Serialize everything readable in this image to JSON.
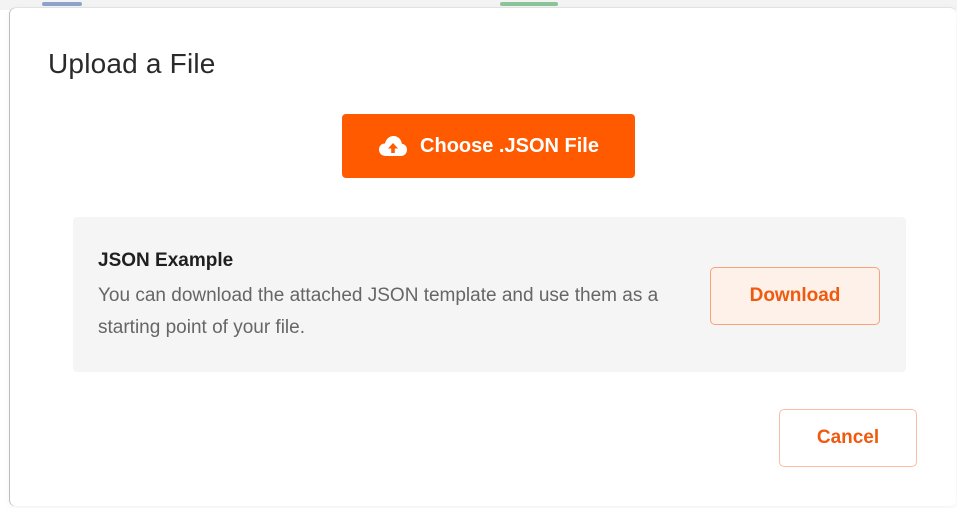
{
  "dialog": {
    "title": "Upload a File"
  },
  "upload": {
    "choose_label": "Choose .JSON File",
    "icon": "cloud-upload-icon"
  },
  "example": {
    "title": "JSON Example",
    "description": "You can download the attached JSON template and use them as a starting point of your file.",
    "download_label": "Download"
  },
  "footer": {
    "cancel_label": "Cancel"
  },
  "colors": {
    "accent": "#ff5a00",
    "accent_text": "#f05a0f",
    "panel_bg": "#f5f5f5",
    "download_bg": "#fdf1ea"
  }
}
